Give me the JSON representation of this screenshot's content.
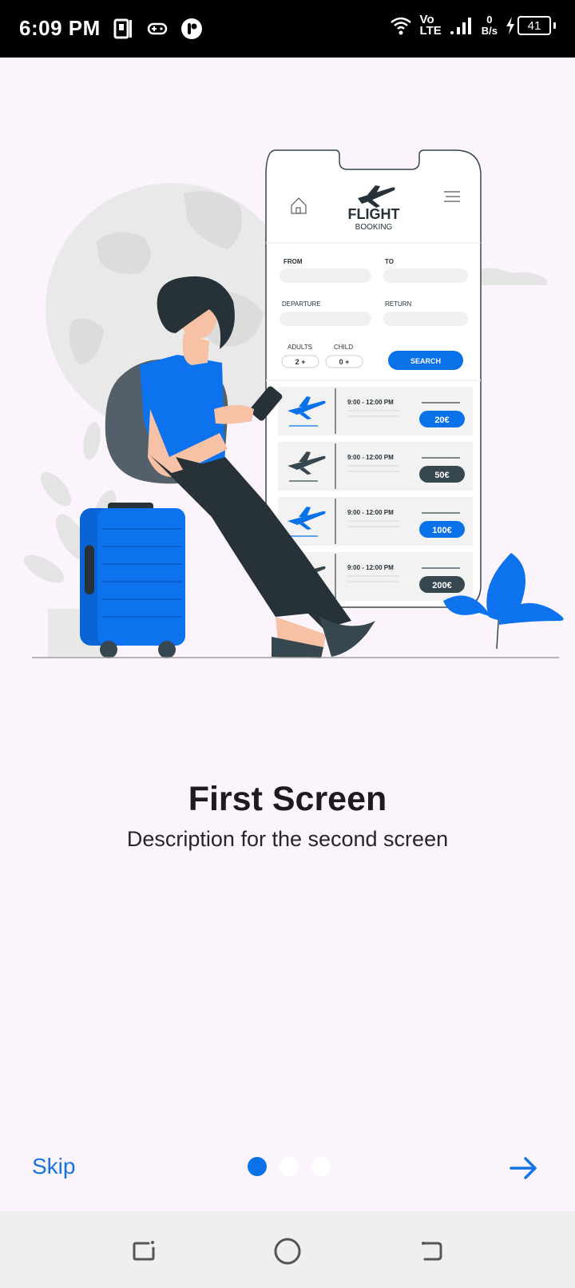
{
  "status_bar": {
    "time": "6:09 PM",
    "network_label_top": "Vo",
    "network_label_bottom": "LTE",
    "speed_value": "0",
    "speed_unit": "B/s",
    "battery": "41"
  },
  "illustration": {
    "app_title": "FLIGHT",
    "app_subtitle": "BOOKING",
    "from_label": "FROM",
    "to_label": "TO",
    "departure_label": "DEPARTURE",
    "return_label": "RETURN",
    "adults_label": "ADULTS",
    "child_label": "CHILD",
    "adults_value": "2 +",
    "child_value": "0 +",
    "search_label": "SEARCH",
    "flights": [
      {
        "time": "9:00 - 12:00 PM",
        "price": "20€"
      },
      {
        "time": "9:00 - 12:00 PM",
        "price": "50€"
      },
      {
        "time": "9:00 - 12:00 PM",
        "price": "100€"
      },
      {
        "time": "9:00 - 12:00 PM",
        "price": "200€"
      }
    ],
    "accent_color": "#0a72e8",
    "dark_color": "#37474f"
  },
  "onboarding": {
    "title": "First Screen",
    "description": "Description for the second screen",
    "skip_label": "Skip",
    "page_index": 1,
    "page_count": 3
  },
  "colors": {
    "background": "#fcf4fc",
    "accent": "#1474e6"
  }
}
